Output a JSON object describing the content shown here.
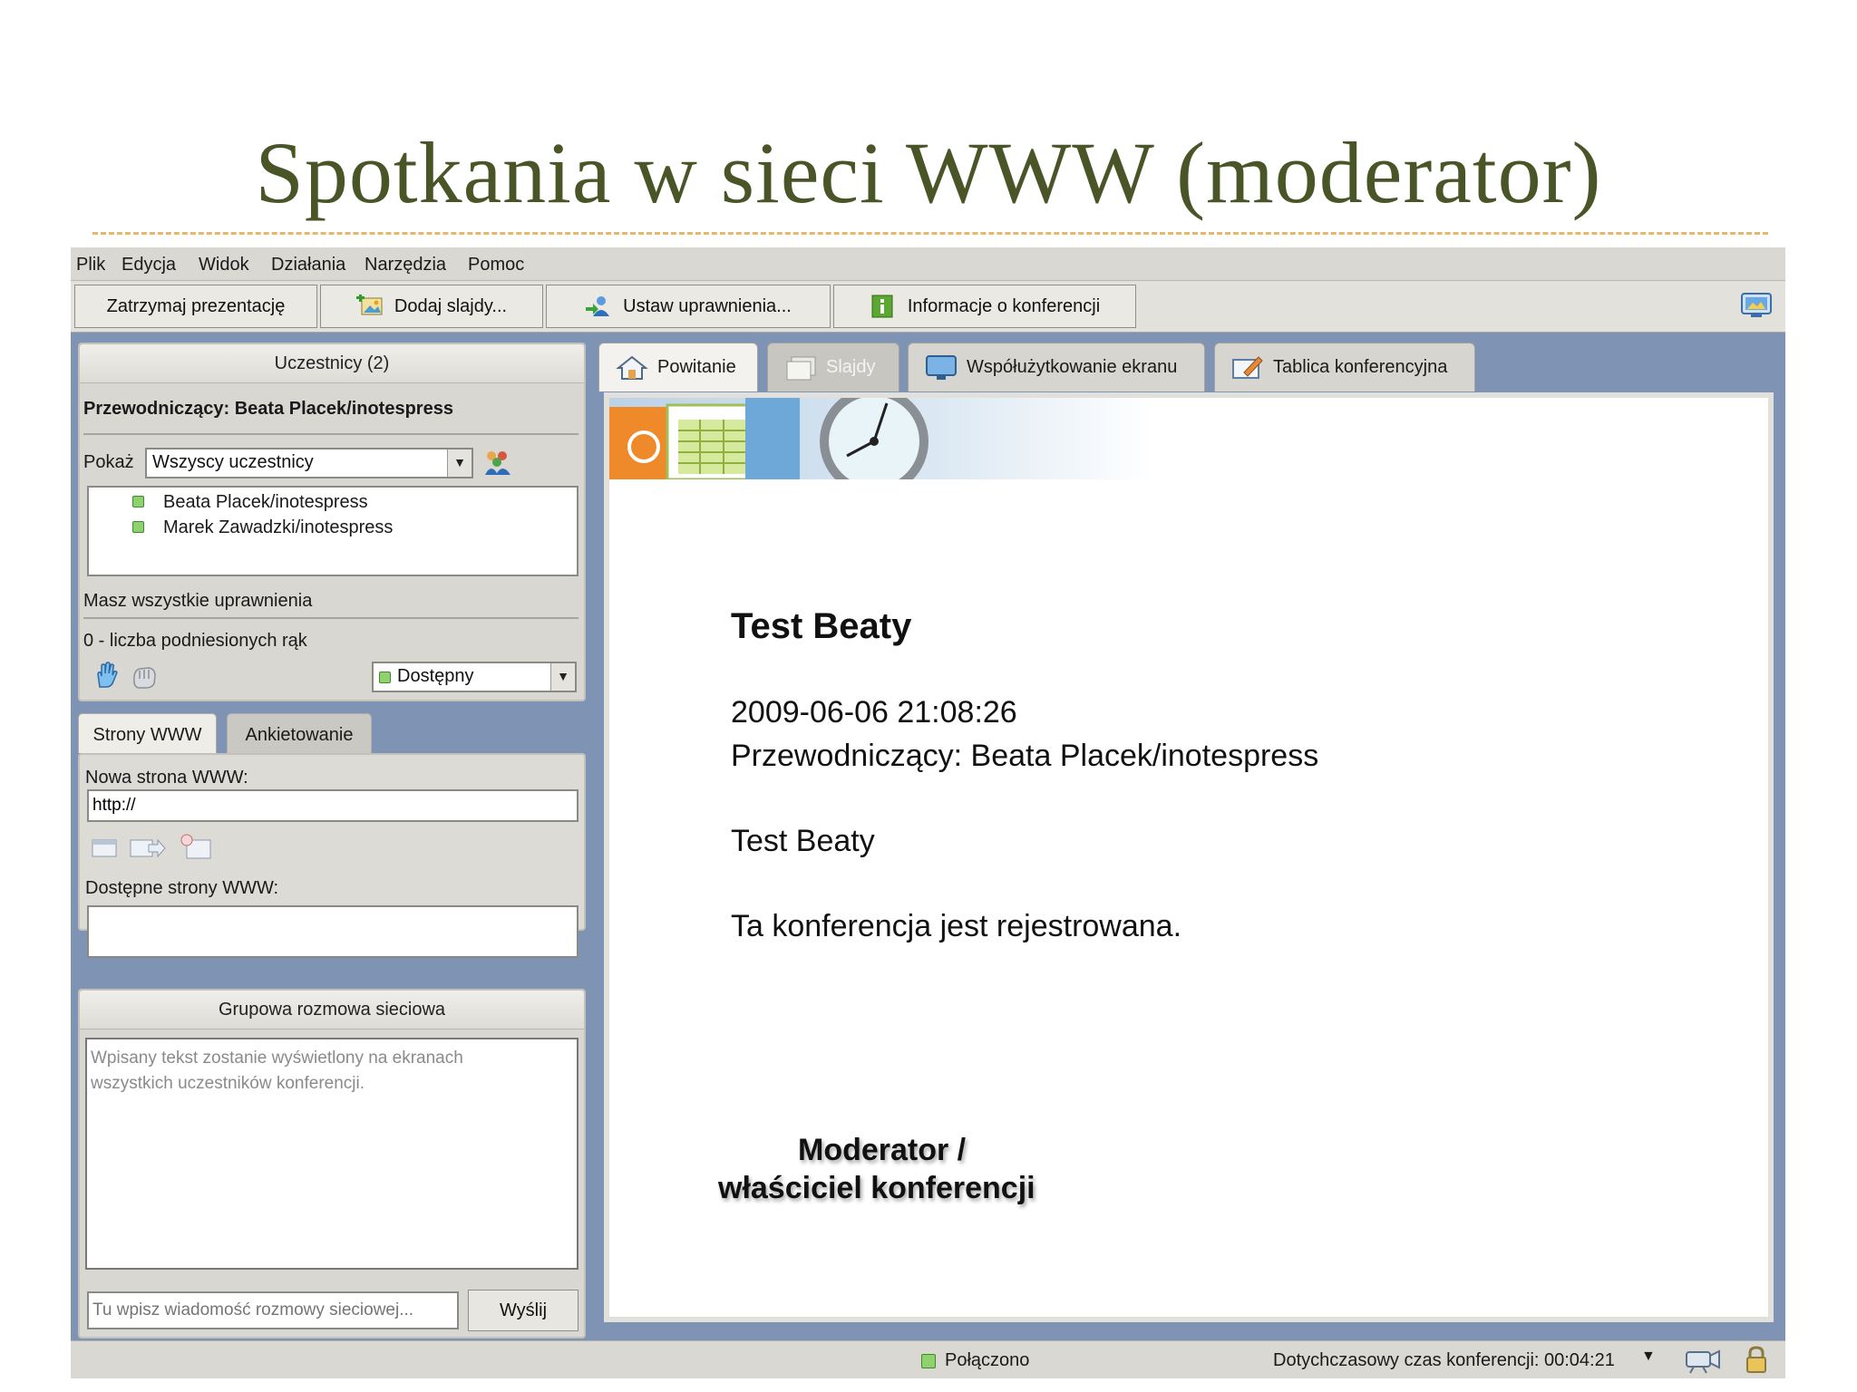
{
  "slide": {
    "title": "Spotkania w sieci WWW (moderator)"
  },
  "menu": [
    "Plik",
    "Edycja",
    "Widok",
    "Działania",
    "Narzędzia",
    "Pomoc"
  ],
  "toolbar": {
    "stop": "Zatrzymaj prezentację",
    "add_slides": "Dodaj slajdy...",
    "permissions": "Ustaw uprawnienia...",
    "info": "Informacje o konferencji"
  },
  "participants": {
    "header": "Uczestnicy (2)",
    "chair": "Przewodniczący: Beata Placek/inotespress",
    "show_label": "Pokaż",
    "filter_value": "Wszyscy uczestnicy",
    "list": [
      "Beata Placek/inotespress",
      "Marek Zawadzki/inotespress"
    ],
    "perm_text": "Masz wszystkie uprawnienia",
    "hands_text": "0 - liczba podniesionych rąk",
    "status_value": "Dostępny"
  },
  "web": {
    "tabs": [
      "Strony WWW",
      "Ankietowanie"
    ],
    "new_label": "Nowa strona WWW:",
    "url_value": "http://",
    "available_label": "Dostępne strony WWW:"
  },
  "chat": {
    "header": "Grupowa rozmowa sieciowa",
    "hint": [
      "Wpisany tekst zostanie wyświetlony na ekranach",
      "wszystkich uczestników konferencji."
    ],
    "input_placeholder": "Tu wpisz wiadomość rozmowy sieciowej...",
    "send": "Wyślij"
  },
  "tabs": [
    "Powitanie",
    "Slajdy",
    "Współużytkowanie ekranu",
    "Tablica konferencyjna"
  ],
  "welcome": {
    "title": "Test Beaty",
    "datetime": "2009-06-06 21:08:26",
    "chair": "Przewodniczący: Beata Placek/inotespress",
    "subtitle": "Test Beaty",
    "recording": "Ta konferencja jest rejestrowana."
  },
  "annotation": [
    "Moderator /",
    "właściciel konferencji"
  ],
  "status": {
    "connected": "Połączono",
    "time": "Dotychczasowy czas konferencji: 00:04:21"
  },
  "colors": {
    "title": "#4a5527",
    "frame": "#7f94b4",
    "available": "#8fd16f"
  }
}
